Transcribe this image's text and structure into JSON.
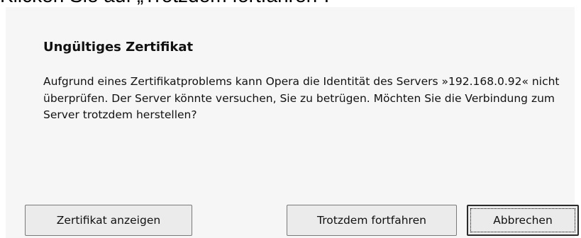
{
  "page": {
    "partial_heading": "Klicken Sie auf „Trotzdem fortfahren“."
  },
  "dialog": {
    "title": "Ungültiges Zertifikat",
    "message": "Aufgrund eines Zertifikatproblems kann Opera die Identität des Servers »192.168.0.92« nicht überprüfen. Der Server könnte versuchen, Sie zu betrügen. Möchten Sie die Verbindung zum Server trotzdem herstellen?",
    "buttons": {
      "show_certificate": "Zertifikat anzeigen",
      "continue_anyway": "Trotzdem fortfahren",
      "cancel": "Abbrechen"
    },
    "focused_button": "cancel"
  }
}
